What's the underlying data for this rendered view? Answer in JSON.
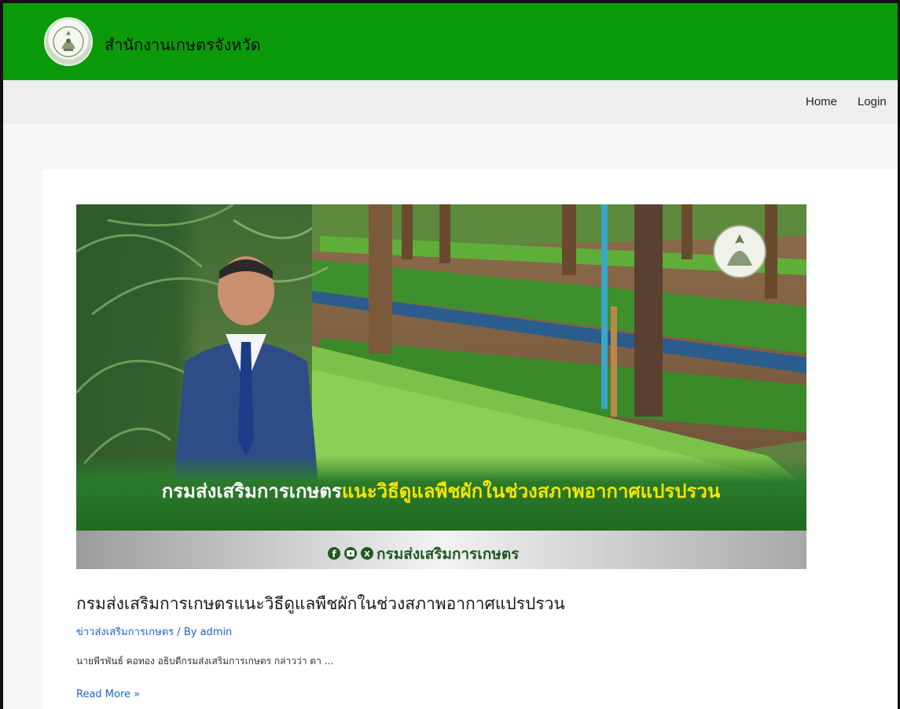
{
  "header": {
    "site_title": "สำนักงานเกษตรจังหวัด",
    "background_color": "#0a9a0a"
  },
  "nav": {
    "items": [
      {
        "label": "Home"
      },
      {
        "label": "Login"
      }
    ]
  },
  "post": {
    "banner": {
      "headline_part1": "กรมส่งเสริมการเกษตร",
      "headline_part2": "แนะวิธีดูแลพืชผักในช่วงสภาพอากาศแปรปรวน",
      "footer_text": "กรมส่งเสริมการเกษตร",
      "social_icons": [
        "facebook-icon",
        "youtube-icon",
        "x-icon"
      ]
    },
    "title": "กรมส่งเสริมการเกษตรแนะวิธีดูแลพืชผักในช่วงสภาพอากาศแปรปรวน",
    "category": "ข่าวส่งเสริมการเกษตร",
    "separator": " / By ",
    "author": "admin",
    "excerpt": "นายพีรพันธ์ คอทอง อธิบดีกรมส่งเสริมการเกษตร กล่าวว่า ตา …",
    "read_more": "Read More »"
  },
  "colors": {
    "link": "#1a66c9",
    "banner_headline_white": "#ffffff",
    "banner_headline_yellow": "#f4e400"
  }
}
